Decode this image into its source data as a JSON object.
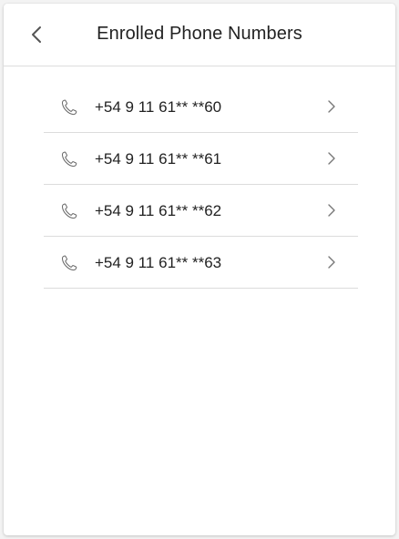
{
  "header": {
    "title": "Enrolled Phone Numbers",
    "back_icon": "chevron-left-icon"
  },
  "phones": [
    {
      "number": "+54 9 11 61** **60",
      "icon": "phone-icon"
    },
    {
      "number": "+54 9 11 61** **61",
      "icon": "phone-icon"
    },
    {
      "number": "+54 9 11 61** **62",
      "icon": "phone-icon"
    },
    {
      "number": "+54 9 11 61** **63",
      "icon": "phone-icon"
    }
  ],
  "colors": {
    "text": "#222222",
    "divider": "#dcdcdc",
    "icon": "#666666"
  }
}
